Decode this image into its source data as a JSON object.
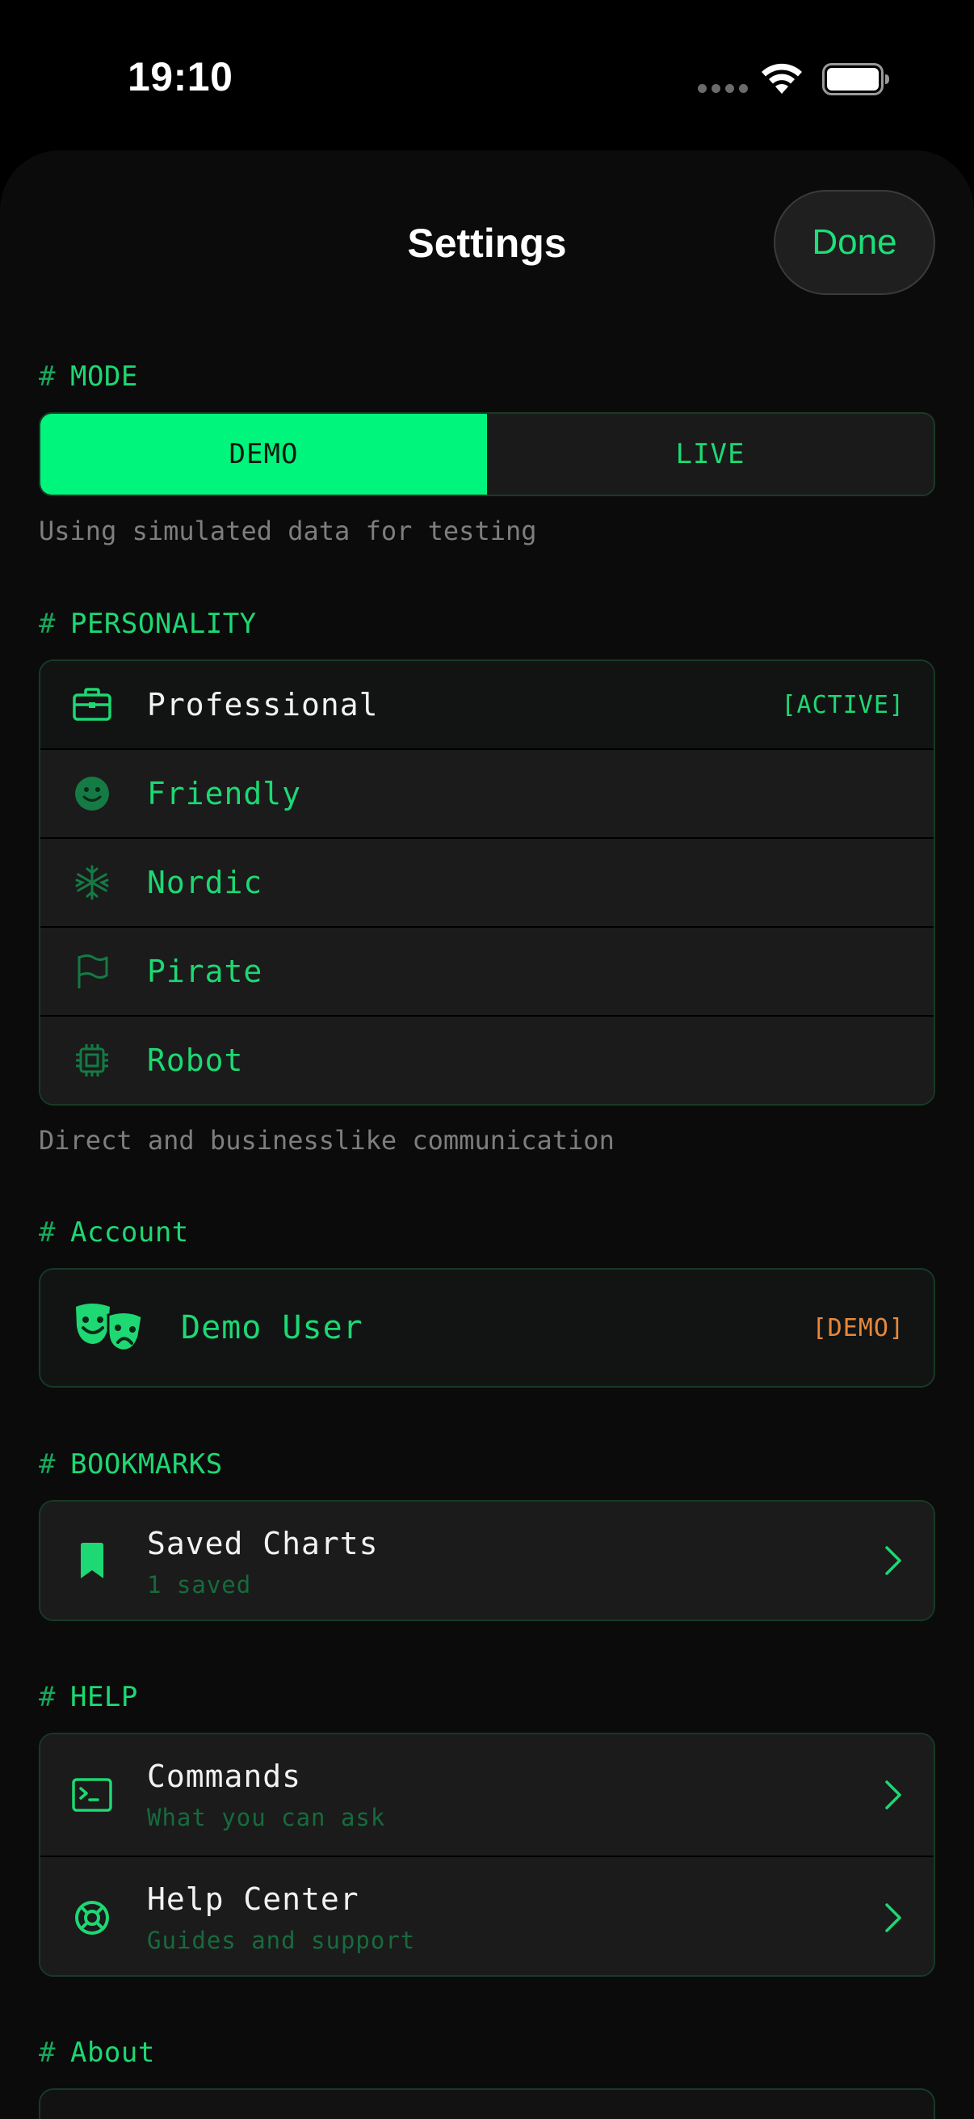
{
  "status_bar": {
    "time": "19:10"
  },
  "header": {
    "title": "Settings",
    "done_label": "Done"
  },
  "mode": {
    "hash": "#",
    "title": "MODE",
    "options": [
      "DEMO",
      "LIVE"
    ],
    "selected": "DEMO",
    "caption": "Using simulated data for testing"
  },
  "personality": {
    "hash": "#",
    "title": "PERSONALITY",
    "items": [
      {
        "label": "Professional",
        "icon": "briefcase-icon",
        "badge": "[ACTIVE]"
      },
      {
        "label": "Friendly",
        "icon": "smiley-icon"
      },
      {
        "label": "Nordic",
        "icon": "snowflake-icon"
      },
      {
        "label": "Pirate",
        "icon": "flag-icon"
      },
      {
        "label": "Robot",
        "icon": "cpu-chip-icon"
      }
    ],
    "caption": "Direct and businesslike communication"
  },
  "account": {
    "hash": "#",
    "title": "Account",
    "user": "Demo User",
    "badge": "[DEMO]",
    "icon": "theater-masks-icon"
  },
  "bookmarks": {
    "hash": "#",
    "title": "BOOKMARKS",
    "item": {
      "title": "Saved Charts",
      "subtitle": "1 saved",
      "icon": "bookmark-icon"
    }
  },
  "help": {
    "hash": "#",
    "title": "HELP",
    "items": [
      {
        "title": "Commands",
        "subtitle": "What you can ask",
        "icon": "terminal-icon"
      },
      {
        "title": "Help Center",
        "subtitle": "Guides and support",
        "icon": "lifebuoy-icon"
      }
    ]
  },
  "about": {
    "hash": "#",
    "title": "About"
  },
  "colors": {
    "accent": "#00f57d",
    "text_green": "#1dd873",
    "demo_badge": "#e8883a",
    "background": "#0b0b0b"
  }
}
